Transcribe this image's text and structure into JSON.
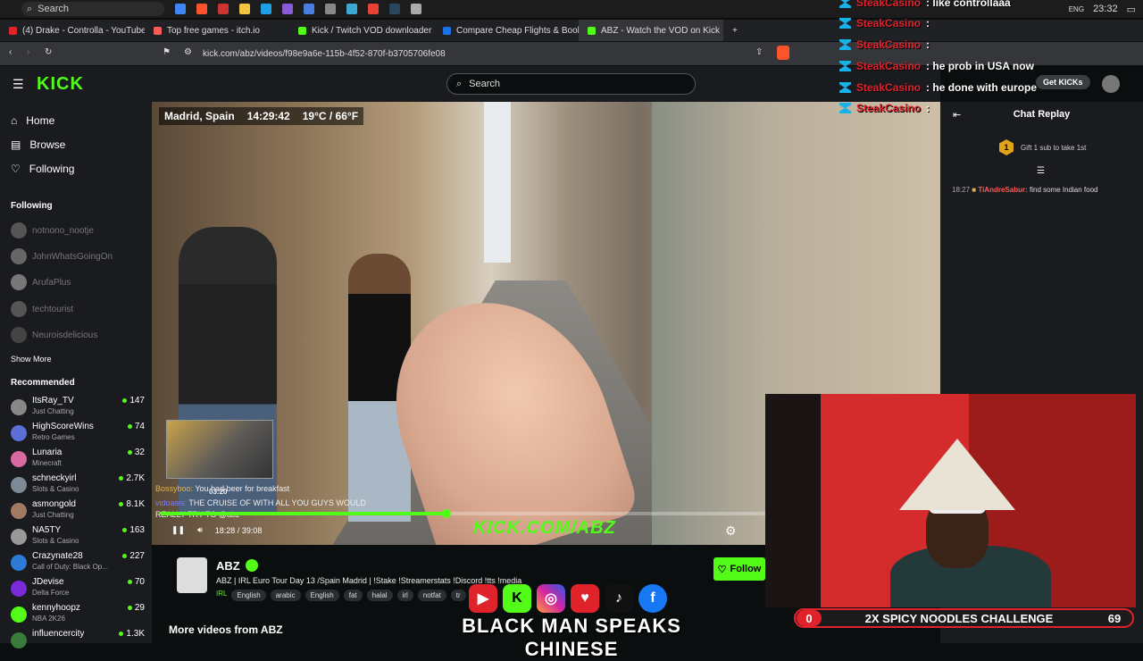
{
  "taskbar": {
    "search_placeholder": "Search",
    "lang": "ENG",
    "lang_sub": "US",
    "time": "23:32"
  },
  "tabs": [
    {
      "label": "(4) Drake - Controlla - YouTube",
      "color": "#e0232b"
    },
    {
      "label": "Top free games - itch.io",
      "color": "#fa5c5c"
    },
    {
      "label": "Kick / Twitch VOD downloader",
      "color": "#53fc18"
    },
    {
      "label": "Compare Cheap Flights & Book Airline",
      "color": "#1a73e8"
    },
    {
      "label": "ABZ - Watch the VOD on Kick",
      "color": "#53fc18"
    }
  ],
  "address": {
    "url": "kick.com/abz/videos/f98e9a6e-115b-4f52-870f-b3705706fe08"
  },
  "kick": {
    "logo": "KICK",
    "search_placeholder": "Search",
    "get_kicks": "Get KICKs"
  },
  "sidebar": {
    "nav": [
      {
        "label": "Home"
      },
      {
        "label": "Browse"
      },
      {
        "label": "Following"
      }
    ],
    "following_title": "Following",
    "following": [
      "notnono_nootje",
      "JohnWhatsGoingOn",
      "ArufaPlus",
      "techtourist",
      "Neuroisdelicious"
    ],
    "show_more": "Show More",
    "recommended_title": "Recommended",
    "recommended": [
      {
        "name": "ItsRay_TV",
        "cat": "Just Chatting",
        "count": "147"
      },
      {
        "name": "HighScoreWins",
        "cat": "Retro Games",
        "count": "74"
      },
      {
        "name": "Lunaria",
        "cat": "Minecraft",
        "count": "32"
      },
      {
        "name": "schneckyirl",
        "cat": "Slots & Casino",
        "count": "2.7K"
      },
      {
        "name": "asmongold",
        "cat": "Just Chatting",
        "count": "8.1K"
      },
      {
        "name": "NA5TY",
        "cat": "Slots & Casino",
        "count": "163"
      },
      {
        "name": "Crazynate28",
        "cat": "Call of Duty: Black Op...",
        "count": "227"
      },
      {
        "name": "JDevise",
        "cat": "Delta Force",
        "count": "70"
      },
      {
        "name": "kennyhoopz",
        "cat": "NBA 2K26",
        "count": "29"
      },
      {
        "name": "influencercity",
        "cat": "",
        "count": "1.3K"
      }
    ]
  },
  "video": {
    "location": "Madrid, Spain",
    "clock": "14:29:42",
    "weather": "19°C / 66°F",
    "thumb_time": "03:20",
    "chat1_user": "Bossyboo:",
    "chat1_msg": "You had beer for breakfast",
    "chat2_user": "vidoasis:",
    "chat2_msg": "THE CRUISE OF WITH ALL YOU GUYS WOULD",
    "chat3": "REALLY TRY TO @abz",
    "current_time": "18:28",
    "duration": "39:08",
    "progress": 0.47,
    "watermark": "KICK.COM/ABZ"
  },
  "channel": {
    "name": "ABZ",
    "title": "ABZ | IRL Euro Tour Day 13 /Spain Madrid | !Stake !Streamerstats !Discord !tts !media",
    "lang": "IRL",
    "tags": [
      "English",
      "arabic",
      "English",
      "fat",
      "halal",
      "irl",
      "notfat",
      "tr"
    ],
    "follow": "Follow",
    "more_videos": "More videos from ABZ"
  },
  "chat": {
    "title": "Chat Replay",
    "gift_count": "1",
    "gift_text": "Gift 1 sub to take 1st",
    "message": {
      "time": "18:27",
      "user": "TiAndreSabur:",
      "text": "find some Indian food"
    }
  },
  "overlay_chat": [
    {
      "user": "SteakCasino",
      "msg": ": like controllaaa"
    },
    {
      "user": "SteakCasino",
      "msg": ":"
    },
    {
      "user": "SteakCasino",
      "msg": ":"
    },
    {
      "user": "SteakCasino",
      "msg": ": he prob in USA now"
    },
    {
      "user": "SteakCasino",
      "msg": ": he done with europe"
    },
    {
      "user": "SteakCasino",
      "msg": ":"
    }
  ],
  "stream_overlay": {
    "caption": "BLACK MAN SPEAKS CHINESE",
    "challenge_left": "0",
    "challenge_text": "2X SPICY NOODLES CHALLENGE",
    "challenge_right": "69"
  },
  "colors": {
    "kick_green": "#53fc18",
    "brand_red": "#e0232b",
    "panel": "#191b1f"
  }
}
